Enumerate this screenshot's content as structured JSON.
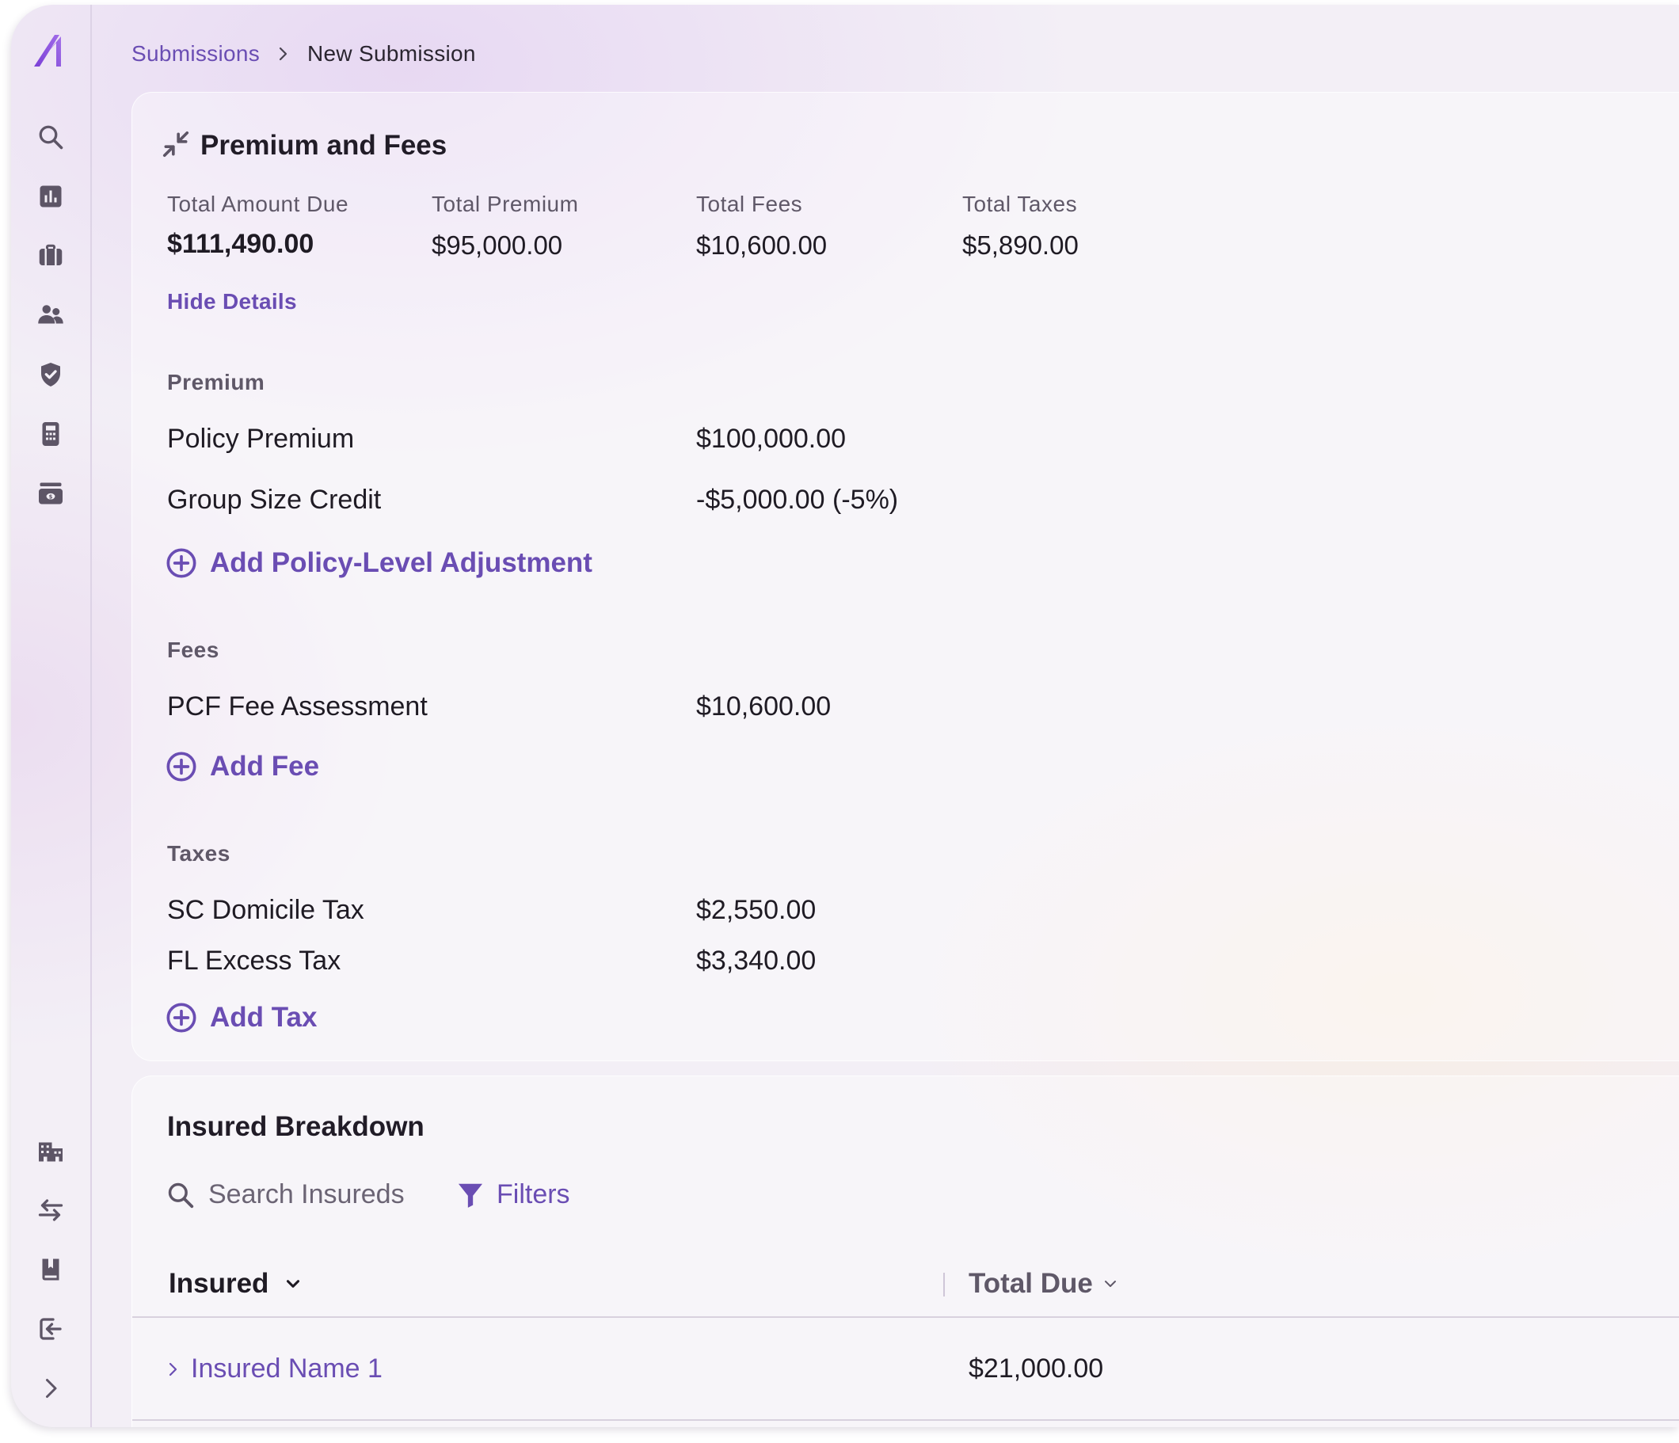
{
  "sidebar": {
    "top_icons": [
      "search-icon",
      "bar-chart-icon",
      "briefcase-icon",
      "people-icon",
      "shield-check-icon",
      "calculator-icon",
      "billing-icon"
    ],
    "bottom_icons": [
      "building-icon",
      "swap-arrows-icon",
      "book-icon",
      "logout-icon",
      "chevron-right-icon"
    ]
  },
  "breadcrumb": {
    "parent": "Submissions",
    "current": "New Submission"
  },
  "premium_card": {
    "title": "Premium and Fees",
    "summary": {
      "total_amount_due_label": "Total Amount Due",
      "total_amount_due_value": "$111,490.00",
      "total_premium_label": "Total Premium",
      "total_premium_value": "$95,000.00",
      "total_fees_label": "Total Fees",
      "total_fees_value": "$10,600.00",
      "total_taxes_label": "Total Taxes",
      "total_taxes_value": "$5,890.00"
    },
    "hide_details": "Hide Details",
    "premium": {
      "label": "Premium",
      "rows": [
        {
          "label": "Policy Premium",
          "value": "$100,000.00"
        },
        {
          "label": "Group Size Credit",
          "value": "-$5,000.00 (-5%)"
        }
      ],
      "add_label": "Add Policy-Level Adjustment"
    },
    "fees": {
      "label": "Fees",
      "rows": [
        {
          "label": "PCF Fee Assessment",
          "value": "$10,600.00"
        }
      ],
      "add_label": "Add Fee"
    },
    "taxes": {
      "label": "Taxes",
      "rows": [
        {
          "label": "SC Domicile Tax",
          "value": "$2,550.00"
        },
        {
          "label": "FL Excess Tax",
          "value": "$3,340.00"
        }
      ],
      "add_label": "Add Tax"
    }
  },
  "insured_card": {
    "title": "Insured Breakdown",
    "search_placeholder": "Search Insureds",
    "filters_label": "Filters",
    "columns": [
      "Insured",
      "Total Due"
    ],
    "rows": [
      {
        "name": "Insured Name 1",
        "total_due": "$21,000.00"
      }
    ]
  },
  "colors": {
    "accent": "#6a4db3",
    "text": "#1f1b24",
    "muted": "#5f5868"
  }
}
